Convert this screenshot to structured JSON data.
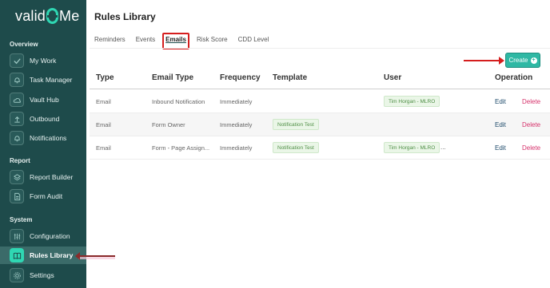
{
  "logo": {
    "part1": "valid",
    "part2": "Me"
  },
  "sidebar": {
    "sections": [
      {
        "title": "Overview"
      },
      {
        "title": "Report"
      },
      {
        "title": "System"
      }
    ],
    "items": [
      {
        "label": "My Work",
        "icon": "check-icon"
      },
      {
        "label": "Task Manager",
        "icon": "bell-icon"
      },
      {
        "label": "Vault Hub",
        "icon": "cloud-icon"
      },
      {
        "label": "Outbound",
        "icon": "upload-icon"
      },
      {
        "label": "Notifications",
        "icon": "bell-icon"
      },
      {
        "label": "Report Builder",
        "icon": "layers-icon"
      },
      {
        "label": "Form Audit",
        "icon": "document-icon"
      },
      {
        "label": "Configuration",
        "icon": "sliders-icon"
      },
      {
        "label": "Rules Library",
        "icon": "book-icon",
        "active": true
      },
      {
        "label": "Settings",
        "icon": "gear-icon"
      }
    ]
  },
  "page": {
    "title": "Rules Library"
  },
  "tabs": [
    {
      "label": "Reminders"
    },
    {
      "label": "Events"
    },
    {
      "label": "Emails",
      "active": true
    },
    {
      "label": "Risk Score"
    },
    {
      "label": "CDD Level"
    }
  ],
  "create_button": {
    "label": "Create",
    "icon": "plus-circle-icon"
  },
  "table": {
    "headers": [
      "Type",
      "Email Type",
      "Frequency",
      "Template",
      "User",
      "Operation"
    ],
    "rows": [
      {
        "type": "Email",
        "email_type": "Inbound Notification",
        "frequency": "Immediately",
        "template": "",
        "user": "Tim Horgan - MLRO",
        "more": "",
        "edit": "Edit",
        "delete": "Delete"
      },
      {
        "type": "Email",
        "email_type": "Form Owner",
        "frequency": "Immediately",
        "template": "Notification Test",
        "user": "",
        "more": "",
        "edit": "Edit",
        "delete": "Delete"
      },
      {
        "type": "Email",
        "email_type": "Form - Page Assign...",
        "frequency": "Immediately",
        "template": "Notification Test",
        "user": "Tim Horgan - MLRO",
        "more": "...",
        "edit": "Edit",
        "delete": "Delete"
      }
    ]
  },
  "colors": {
    "sidebar_bg": "#1e4b4b",
    "accent": "#2fd7b3",
    "button": "#2fb8a4",
    "highlight_red": "#d51e1e",
    "delete": "#d6336c"
  }
}
